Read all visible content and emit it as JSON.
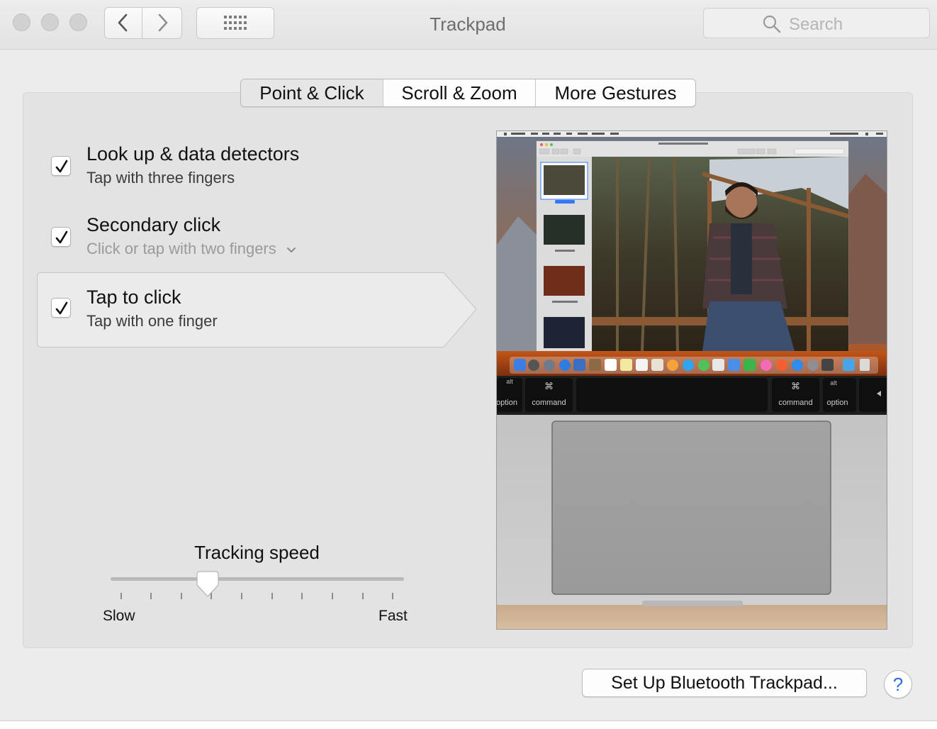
{
  "window": {
    "title": "Trackpad"
  },
  "toolbar": {
    "search_placeholder": "Search"
  },
  "tabs": [
    {
      "label": "Point & Click",
      "selected": true
    },
    {
      "label": "Scroll & Zoom",
      "selected": false
    },
    {
      "label": "More Gestures",
      "selected": false
    }
  ],
  "options": [
    {
      "title": "Look up & data detectors",
      "subtitle": "Tap with three fingers",
      "checked": true
    },
    {
      "title": "Secondary click",
      "subtitle": "Click or tap with two fingers",
      "checked": true,
      "has_dropdown": true
    },
    {
      "title": "Tap to click",
      "subtitle": "Tap with one finger",
      "checked": true,
      "selected": true
    }
  ],
  "tracking_speed": {
    "label": "Tracking speed",
    "min_label": "Slow",
    "max_label": "Fast",
    "value_fraction": 0.33,
    "tick_count": 10
  },
  "preview": {
    "keyboard_keys": [
      {
        "top": "alt",
        "bottom": "option"
      },
      {
        "top": "⌘",
        "bottom": "command"
      },
      {
        "top": "⌘",
        "bottom": "command"
      },
      {
        "top": "alt",
        "bottom": "option"
      }
    ]
  },
  "footer": {
    "bluetooth_button": "Set Up Bluetooth Trackpad...",
    "help_button": "?"
  },
  "colors": {
    "accent": "#2d6be0",
    "window_bg": "#ececec",
    "panel_bg": "#e3e3e3"
  }
}
